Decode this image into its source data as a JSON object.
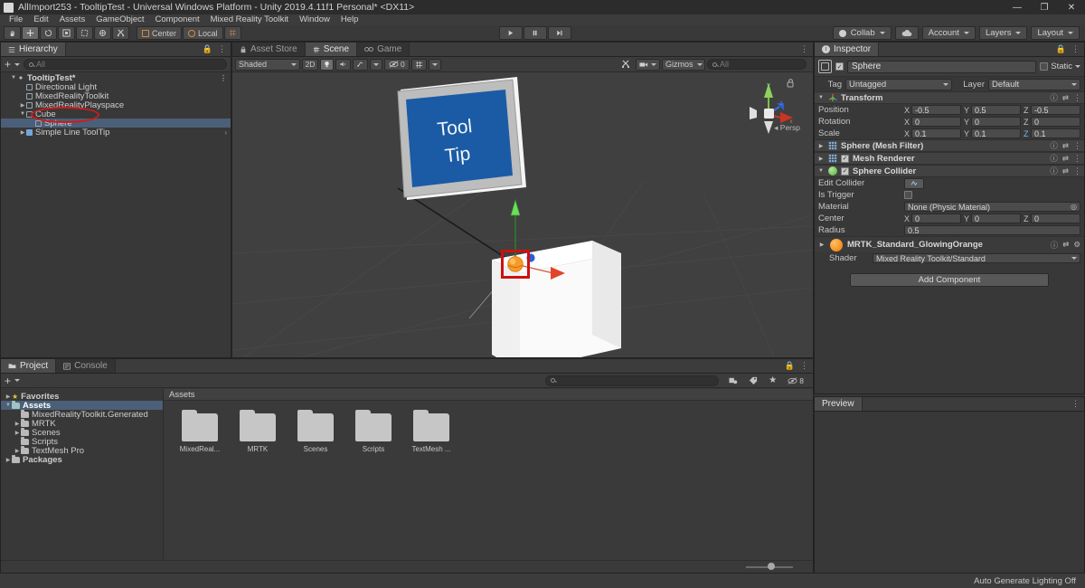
{
  "window": {
    "title": "AllImport253 - TooltipTest - Universal Windows Platform - Unity 2019.4.11f1 Personal* <DX11>",
    "minimize": "—",
    "maximize": "❐",
    "close": "✕"
  },
  "menubar": [
    "File",
    "Edit",
    "Assets",
    "GameObject",
    "Component",
    "Mixed Reality Toolkit",
    "Window",
    "Help"
  ],
  "toolbar": {
    "tools": [
      "hand-tool",
      "move-tool",
      "rotate-tool",
      "scale-tool",
      "rect-tool",
      "transform-tool",
      "custom-tool"
    ],
    "pivot_mode": "Center",
    "pivot_space": "Local",
    "play": "▶",
    "pause": "❙❙",
    "step": "▶|",
    "collab": "Collab",
    "account": "Account",
    "layers": "Layers",
    "layout": "Layout"
  },
  "hierarchy": {
    "tab": "Hierarchy",
    "search_placeholder": "All",
    "items": [
      {
        "label": "TooltipTest*",
        "depth": 0,
        "arrow": "▼",
        "type": "scene",
        "selected": false
      },
      {
        "label": "Directional Light",
        "depth": 1,
        "arrow": "",
        "type": "go",
        "selected": false
      },
      {
        "label": "MixedRealityToolkit",
        "depth": 1,
        "arrow": "",
        "type": "go",
        "selected": false
      },
      {
        "label": "MixedRealityPlayspace",
        "depth": 1,
        "arrow": "▶",
        "type": "go",
        "selected": false
      },
      {
        "label": "Cube",
        "depth": 1,
        "arrow": "▼",
        "type": "go",
        "selected": false
      },
      {
        "label": "Sphere",
        "depth": 2,
        "arrow": "",
        "type": "go",
        "selected": true
      },
      {
        "label": "Simple Line ToolTip",
        "depth": 1,
        "arrow": "▶",
        "type": "prefab",
        "selected": false
      }
    ]
  },
  "scene": {
    "tabs": [
      {
        "label": "Asset Store",
        "active": false,
        "icon": "store-icon"
      },
      {
        "label": "Scene",
        "active": true,
        "icon": "scene-icon"
      },
      {
        "label": "Game",
        "active": false,
        "icon": "game-icon"
      }
    ],
    "shading_mode": "Shaded",
    "mode_2d": "2D",
    "lighting_icon": "light-bulb-icon",
    "audio_icon": "audio-icon",
    "fx_icon": "effects-icon",
    "hidden_count": "0",
    "grid_icon": "grid-snap-icon",
    "tools_icon": "scene-tools-icon",
    "camera_icon": "scene-camera-icon",
    "gizmos": "Gizmos",
    "search_placeholder": "All",
    "projection": "Persp",
    "gizmo_axes": {
      "x": "x",
      "y": "y",
      "z": "z"
    },
    "tooltip_text_line1": "Tool",
    "tooltip_text_line2": "Tip"
  },
  "inspector": {
    "tab": "Inspector",
    "object_name": "Sphere",
    "object_enabled": true,
    "static_label": "Static",
    "tag_label": "Tag",
    "tag_value": "Untagged",
    "layer_label": "Layer",
    "layer_value": "Default",
    "transform": {
      "title": "Transform",
      "rows": [
        {
          "label": "Position",
          "x": "-0.5",
          "y": "0.5",
          "z": "-0.5"
        },
        {
          "label": "Rotation",
          "x": "0",
          "y": "0",
          "z": "0"
        },
        {
          "label": "Scale",
          "x": "0.1",
          "y": "0.1",
          "z": "0.1"
        }
      ]
    },
    "components": [
      {
        "title": "Sphere (Mesh Filter)",
        "checkbox": false,
        "icon_color": "#7fa8cf",
        "expanded": false
      },
      {
        "title": "Mesh Renderer",
        "checkbox": true,
        "icon_color": "#7fa8cf",
        "expanded": false
      },
      {
        "title": "Sphere Collider",
        "checkbox": true,
        "icon_color": "#7ec87e",
        "expanded": true
      }
    ],
    "collider": {
      "edit_collider_label": "Edit Collider",
      "is_trigger_label": "Is Trigger",
      "is_trigger_value": false,
      "material_label": "Material",
      "material_value": "None (Physic Material)",
      "center_label": "Center",
      "center": {
        "x": "0",
        "y": "0",
        "z": "0"
      },
      "radius_label": "Radius",
      "radius_value": "0.5"
    },
    "material": {
      "name": "MRTK_Standard_GlowingOrange",
      "shader_label": "Shader",
      "shader_value": "Mixed Reality Toolkit/Standard",
      "swatch_color": "#f79a28"
    },
    "add_component": "Add Component"
  },
  "preview": {
    "tab": "Preview"
  },
  "project": {
    "tabs": [
      {
        "label": "Project",
        "active": true
      },
      {
        "label": "Console",
        "active": false
      }
    ],
    "search_placeholder": "",
    "hidden_count": "8",
    "tree": [
      {
        "label": "Favorites",
        "depth": 0,
        "arrow": "▶",
        "icon": "star-icon",
        "selected": false
      },
      {
        "label": "Assets",
        "depth": 0,
        "arrow": "▼",
        "icon": "folder-teal-icon",
        "selected": true
      },
      {
        "label": "MixedRealityToolkit.Generated",
        "depth": 1,
        "arrow": "",
        "icon": "folder-icon",
        "selected": false
      },
      {
        "label": "MRTK",
        "depth": 1,
        "arrow": "▶",
        "icon": "folder-icon",
        "selected": false
      },
      {
        "label": "Scenes",
        "depth": 1,
        "arrow": "▶",
        "icon": "folder-icon",
        "selected": false
      },
      {
        "label": "Scripts",
        "depth": 1,
        "arrow": "",
        "icon": "folder-icon",
        "selected": false
      },
      {
        "label": "TextMesh Pro",
        "depth": 1,
        "arrow": "▶",
        "icon": "folder-icon",
        "selected": false
      },
      {
        "label": "Packages",
        "depth": 0,
        "arrow": "▶",
        "icon": "folder-icon",
        "selected": false
      }
    ],
    "breadcrumb": "Assets",
    "assets": [
      {
        "label": "MixedReal...",
        "type": "folder"
      },
      {
        "label": "MRTK",
        "type": "folder"
      },
      {
        "label": "Scenes",
        "type": "folder"
      },
      {
        "label": "Scripts",
        "type": "folder"
      },
      {
        "label": "TextMesh ...",
        "type": "folder"
      }
    ]
  },
  "statusbar": {
    "message": "Auto Generate Lighting Off"
  }
}
